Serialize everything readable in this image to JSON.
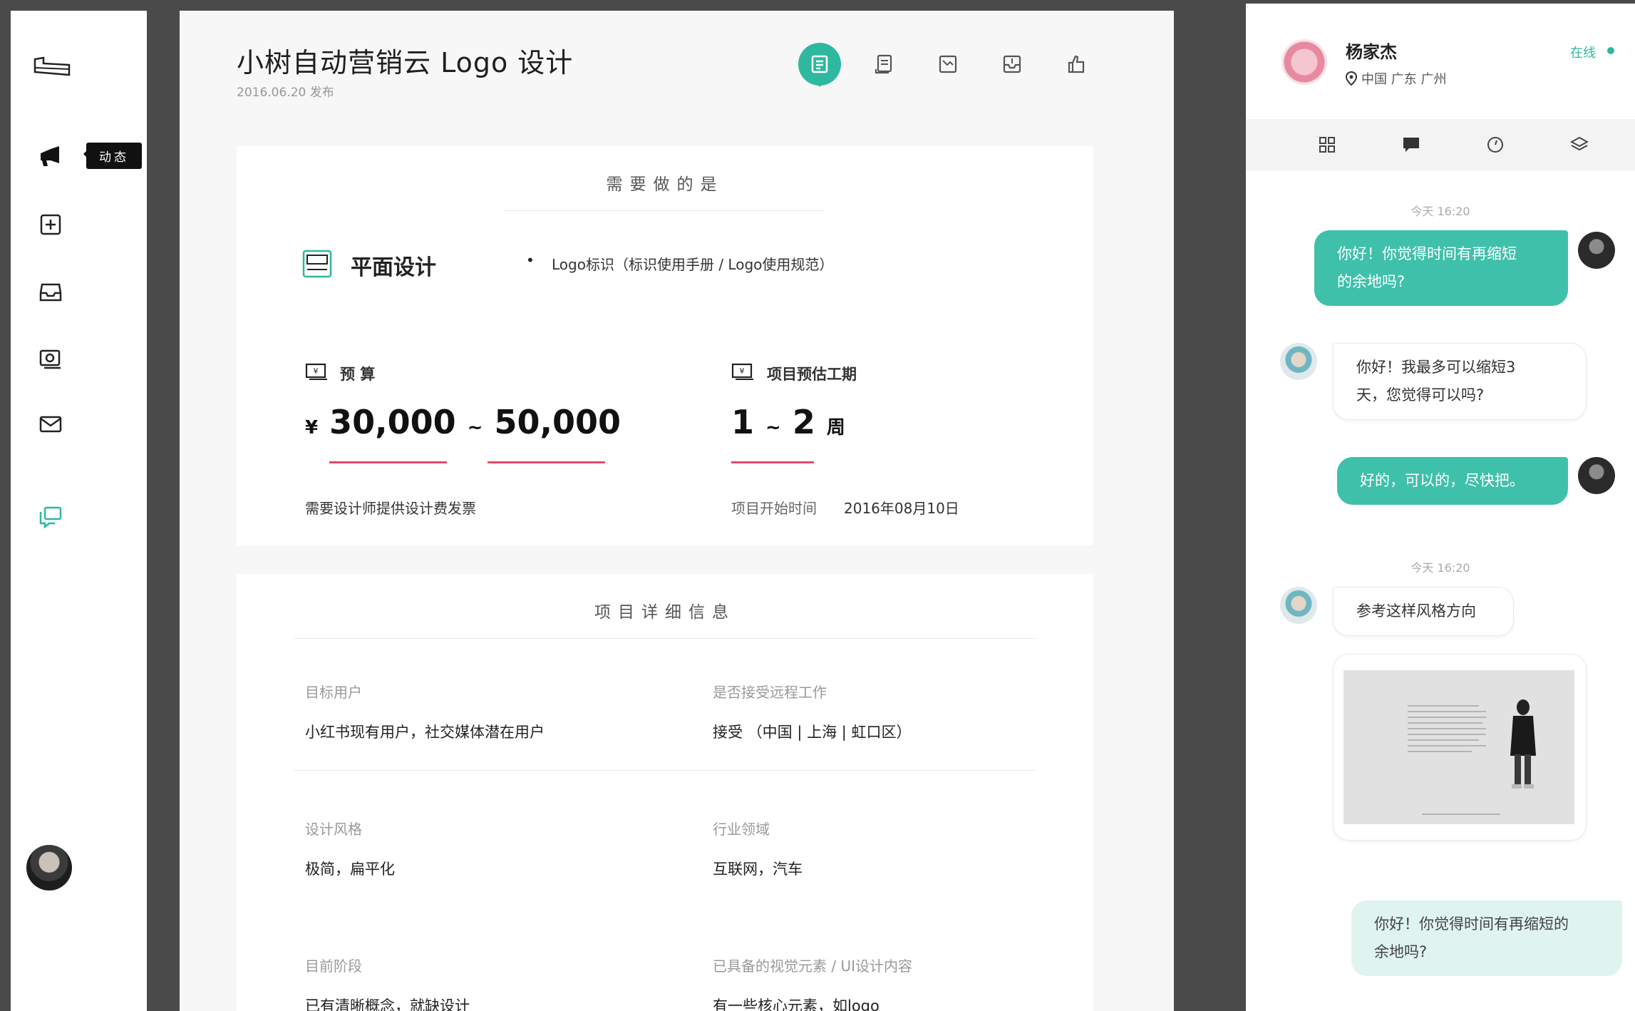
{
  "sidebar": {
    "tooltip": "动态"
  },
  "main": {
    "title": "小树自动营销云 Logo 设计",
    "pubdate": "2016.06.20 发布",
    "requirement": {
      "section_title": "需要做的是",
      "category": "平面设计",
      "item": "Logo标识（标识使用手册 / Logo使用规范）"
    },
    "budget": {
      "label": "预 算",
      "currency": "¥",
      "min": "30,000",
      "sep": "~",
      "max": "50,000",
      "note": "需要设计师提供设计费发票"
    },
    "duration": {
      "label": "项目预估工期",
      "min": "1",
      "sep": "~",
      "max": "2",
      "unit": "周",
      "start_label": "项目开始时间",
      "start_date": "2016年08月10日"
    },
    "details": {
      "section_title": "项目详细信息",
      "items": [
        {
          "label": "目标用户",
          "value": "小红书现有用户，社交媒体潜在用户"
        },
        {
          "label": "是否接受远程工作",
          "value": "接受 （中国 | 上海 | 虹口区）"
        },
        {
          "label": "设计风格",
          "value": "极简，扁平化"
        },
        {
          "label": "行业领域",
          "value": "互联网，汽车"
        },
        {
          "label": "目前阶段",
          "value": "已有清晰概念，就缺设计"
        },
        {
          "label": "已具备的视觉元素 / UI设计内容",
          "value": "有一些核心元素，如logo"
        }
      ]
    }
  },
  "chat": {
    "contact_name": "杨家杰",
    "location": "中国 广东 广州",
    "status": "在线",
    "accent": "#2eb8a0",
    "messages": [
      {
        "time": "今天 16:20"
      },
      {
        "from": "me",
        "text_1": "你好！你觉得时间有再缩短",
        "text_2": "的余地吗?"
      },
      {
        "from": "them",
        "text_1": "你好！我最多可以缩短3",
        "text_2": "天，您觉得可以吗?"
      },
      {
        "from": "me",
        "text_1": "好的，可以的，尽快把。"
      },
      {
        "time": "今天 16:20"
      },
      {
        "from": "them",
        "text_1": "参考这样风格方向"
      },
      {
        "from": "me",
        "text_1": "你好！你觉得时间有再缩短的",
        "text_2": "余地吗?"
      }
    ]
  }
}
